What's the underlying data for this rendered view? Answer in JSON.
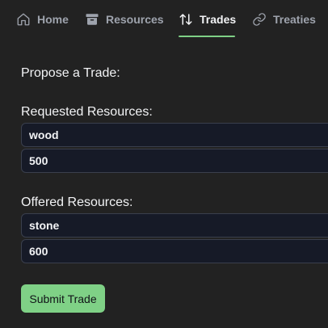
{
  "nav": {
    "tabs": [
      {
        "label": "Home",
        "icon": "home-icon"
      },
      {
        "label": "Resources",
        "icon": "archive-icon"
      },
      {
        "label": "Trades",
        "icon": "swap-arrows-icon",
        "active": true
      },
      {
        "label": "Treaties",
        "icon": "link-icon"
      }
    ],
    "active_color": "#7fd186"
  },
  "form": {
    "title": "Propose a Trade:",
    "requested": {
      "label": "Requested Resources:",
      "resource": "wood",
      "amount": "500"
    },
    "offered": {
      "label": "Offered Resources:",
      "resource": "stone",
      "amount": "600"
    },
    "submit_label": "Submit Trade"
  },
  "colors": {
    "background": "#222222",
    "input_background": "#161a27",
    "accent": "#7fd186"
  }
}
